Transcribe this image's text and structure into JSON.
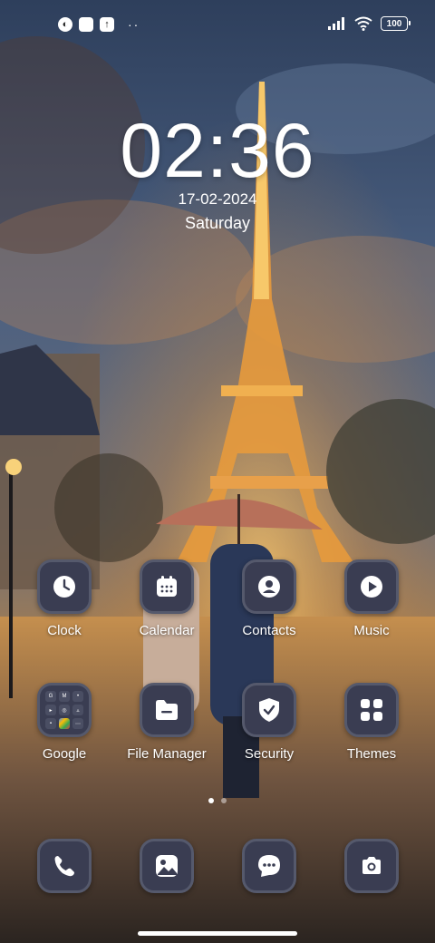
{
  "status_bar": {
    "left_icons": [
      "notification-icon",
      "app-notification-icon",
      "download-icon"
    ],
    "overflow": "··",
    "battery": "100"
  },
  "clock": {
    "time": "02:36",
    "date": "17-02-2024",
    "day": "Saturday"
  },
  "apps": {
    "row1": [
      {
        "label": "Clock",
        "icon": "clock-icon"
      },
      {
        "label": "Calendar",
        "icon": "calendar-icon"
      },
      {
        "label": "Contacts",
        "icon": "contacts-icon"
      },
      {
        "label": "Music",
        "icon": "play-icon"
      }
    ],
    "row2": [
      {
        "label": "Google",
        "icon": "folder-icon"
      },
      {
        "label": "File Manager",
        "icon": "folder-icon"
      },
      {
        "label": "Security",
        "icon": "shield-icon"
      },
      {
        "label": "Themes",
        "icon": "grid-icon"
      }
    ]
  },
  "dock": [
    {
      "icon": "phone-icon"
    },
    {
      "icon": "gallery-icon"
    },
    {
      "icon": "messages-icon"
    },
    {
      "icon": "camera-icon"
    }
  ],
  "pages": {
    "count": 2,
    "active": 1
  },
  "colors": {
    "tile_bg": "#3a3d52",
    "tile_border": "#55596c",
    "text": "#ffffff"
  }
}
